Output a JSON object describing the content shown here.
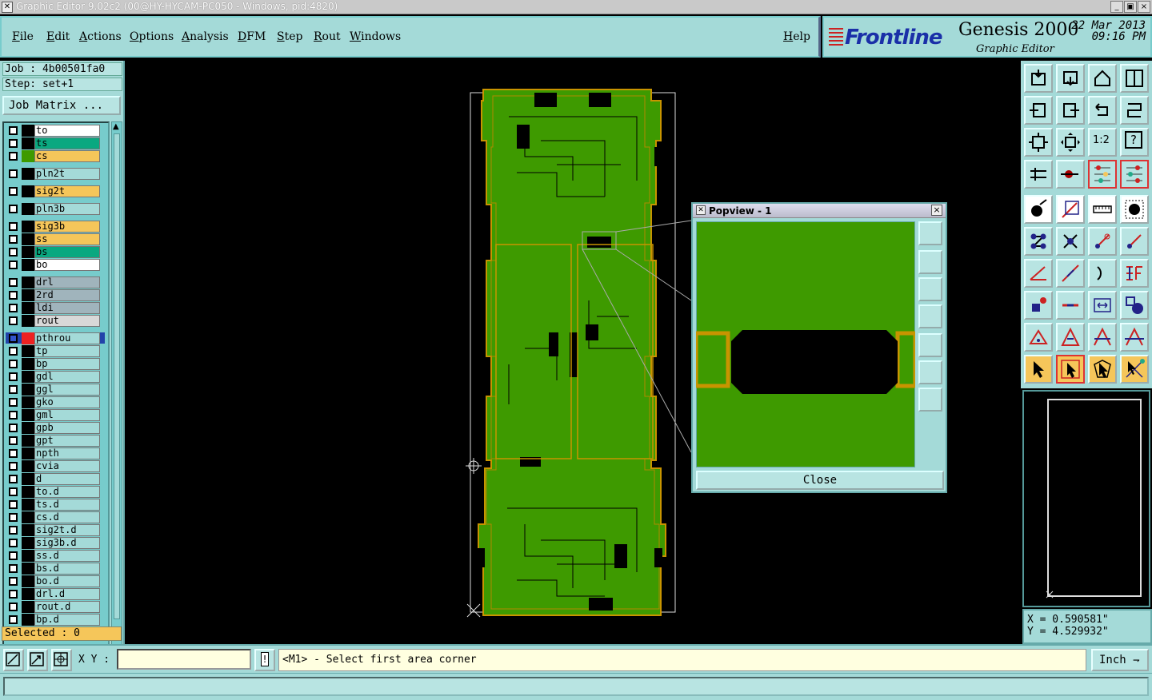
{
  "window": {
    "title": "Graphic Editor 9.02c2 (00@HY-HYCAM-PC050 - Windows, pid:4820)",
    "min_glyph": "_",
    "max_glyph": "▣",
    "close_glyph": "×"
  },
  "menu": [
    "File",
    "Edit",
    "Actions",
    "Options",
    "Analysis",
    "DFM",
    "Step",
    "Rout",
    "Windows"
  ],
  "help_label": "Help",
  "brand": {
    "logo": "Frontline",
    "product": "Genesis 2000",
    "subtitle": "Graphic Editor",
    "date": "22 Mar 2013",
    "time": "09:16 PM"
  },
  "job": {
    "job_line": "Job : 4b00501fa0",
    "step_line": "Step: set+1",
    "matrix_button": "Job Matrix ..."
  },
  "layers": [
    {
      "name": "to",
      "color": "#ffffff"
    },
    {
      "name": "ts",
      "color": "#0aa880"
    },
    {
      "name": "cs",
      "color": "#f5c65a"
    },
    {
      "name": "pln2t",
      "color": "#a4dad8"
    },
    {
      "name": "sig2t",
      "color": "#f5c65a"
    },
    {
      "name": "pln3b",
      "color": "#a4dad8"
    },
    {
      "name": "sig3b",
      "color": "#f5c65a"
    },
    {
      "name": "ss",
      "color": "#f5c65a"
    },
    {
      "name": "bs",
      "color": "#0aa880"
    },
    {
      "name": "bo",
      "color": "#ffffff"
    },
    {
      "name": "drl",
      "color": "#a0b4bc"
    },
    {
      "name": "2rd",
      "color": "#a0b4bc"
    },
    {
      "name": "ldi",
      "color": "#a0b4bc"
    },
    {
      "name": "rout",
      "color": "#d8d8d8"
    },
    {
      "name": "pthrou",
      "color": "#a4dad8"
    },
    {
      "name": "tp",
      "color": "#a4dad8"
    },
    {
      "name": "bp",
      "color": "#a4dad8"
    },
    {
      "name": "gdl",
      "color": "#a4dad8"
    },
    {
      "name": "ggl",
      "color": "#a4dad8"
    },
    {
      "name": "gko",
      "color": "#a4dad8"
    },
    {
      "name": "gml",
      "color": "#a4dad8"
    },
    {
      "name": "gpb",
      "color": "#a4dad8"
    },
    {
      "name": "gpt",
      "color": "#a4dad8"
    },
    {
      "name": "npth",
      "color": "#a4dad8"
    },
    {
      "name": "cvia",
      "color": "#a4dad8"
    },
    {
      "name": "d",
      "color": "#a4dad8"
    },
    {
      "name": "to.d",
      "color": "#a4dad8"
    },
    {
      "name": "ts.d",
      "color": "#a4dad8"
    },
    {
      "name": "cs.d",
      "color": "#a4dad8"
    },
    {
      "name": "sig2t.d",
      "color": "#a4dad8"
    },
    {
      "name": "sig3b.d",
      "color": "#a4dad8"
    },
    {
      "name": "ss.d",
      "color": "#a4dad8"
    },
    {
      "name": "bs.d",
      "color": "#a4dad8"
    },
    {
      "name": "bo.d",
      "color": "#a4dad8"
    },
    {
      "name": "drl.d",
      "color": "#a4dad8"
    },
    {
      "name": "rout.d",
      "color": "#a4dad8"
    },
    {
      "name": "bp.d",
      "color": "#a4dad8"
    }
  ],
  "selected_text": "Selected : 0",
  "popview": {
    "title": "Popview - 1",
    "close_button": "Close"
  },
  "coords": {
    "x": "X = 0.590581\"",
    "y": "Y = 4.529932\""
  },
  "bottom": {
    "xy_label": "X Y :",
    "xy_value": "",
    "prompt": "<M1> - Select first area corner",
    "unit": "Inch",
    "unit_arrow": "⇁"
  },
  "tool_labels": {
    "ratio": "1:2",
    "question": "?"
  },
  "colors": {
    "panel": "#a4dad8",
    "board": "#3e9a00",
    "board_outline": "#c89400",
    "highlight": "#f5c65a"
  }
}
